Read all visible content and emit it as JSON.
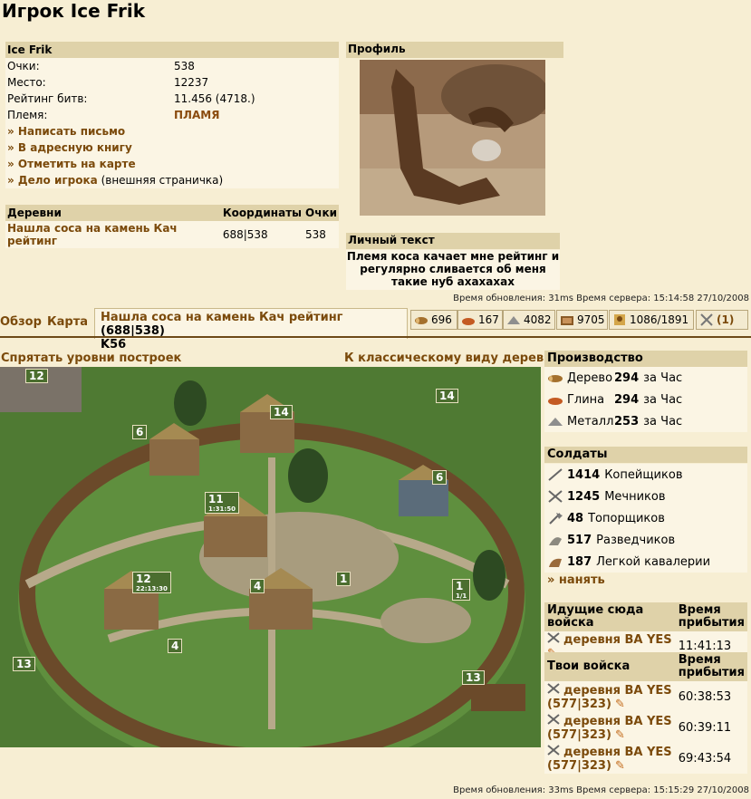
{
  "page_title": "Игрок Ice Frik",
  "player": {
    "name": "Ice Frik",
    "points_label": "Очки:",
    "points": "538",
    "rank_label": "Место:",
    "rank": "12237",
    "battle_label": "Рейтинг битв:",
    "battle": "11.456 (4718.)",
    "tribe_label": "Племя:",
    "tribe": "ПЛАМЯ"
  },
  "actions": [
    {
      "label": "» Написать письмо"
    },
    {
      "label": "» В адресную книгу"
    },
    {
      "label": "» Отметить на карте"
    },
    {
      "label": "» Дело игрока",
      "suffix": "(внешняя страничка)"
    }
  ],
  "villages": {
    "col_village": "Деревни",
    "col_coords": "Координаты",
    "col_points": "Очки",
    "rows": [
      {
        "name": "Нашла coca на камень Кач рейтинг",
        "coords": "688|538",
        "points": "538"
      }
    ]
  },
  "profile": {
    "title": "Профиль",
    "personal_title": "Личный текст",
    "personal_text": "Племя коса качает мне рейтинг и регулярно сливается об меня такие нуб ахахахах"
  },
  "time1": "Время обновления: 31ms Время сервера: 15:14:58 27/10/2008",
  "nav": {
    "overview": "Обзор",
    "map": "Карта",
    "village_name": "Нашла coca на камень Кач рейтинг",
    "village_coords": "(688|538)",
    "village_k": "K56"
  },
  "resources": {
    "wood": "696",
    "clay": "167",
    "iron": "4082",
    "storage": "9705",
    "farm": "1086/1891",
    "attacks": "(1)"
  },
  "map_links": {
    "hide_levels": "Спрятать уровни построек",
    "classic_view": "К классическому виду деревни"
  },
  "buildings": [
    {
      "level": "12"
    },
    {
      "level": "14"
    },
    {
      "level": "6"
    },
    {
      "level": "14"
    },
    {
      "level": "6"
    },
    {
      "level": "11",
      "timer": "1:31:50"
    },
    {
      "level": "12",
      "timer": "22:13:30"
    },
    {
      "level": "4"
    },
    {
      "level": "1"
    },
    {
      "level": "1",
      "timer": "1/1"
    },
    {
      "level": "4"
    },
    {
      "level": "13"
    },
    {
      "level": "13"
    }
  ],
  "production": {
    "title": "Производство",
    "rows": [
      {
        "name": "Дерево",
        "value": "294",
        "unit": "за Час"
      },
      {
        "name": "Глина",
        "value": "294",
        "unit": "за Час"
      },
      {
        "name": "Металл",
        "value": "253",
        "unit": "за Час"
      }
    ]
  },
  "soldiers": {
    "title": "Солдаты",
    "rows": [
      {
        "count": "1414",
        "name": "Копейщиков"
      },
      {
        "count": "1245",
        "name": "Мечников"
      },
      {
        "count": "48",
        "name": "Топорщиков"
      },
      {
        "count": "517",
        "name": "Разведчиков"
      },
      {
        "count": "187",
        "name": "Легкой кавалерии"
      }
    ],
    "hire": "» нанять"
  },
  "incoming": {
    "title": "Идущие сюда войска",
    "time_col": "Время прибытия",
    "rows": [
      {
        "name": "деревня BA YES",
        "time": "11:41:13"
      }
    ]
  },
  "own": {
    "title": "Твои войска",
    "time_col": "Время прибытия",
    "rows": [
      {
        "name": "деревня BA YES",
        "coords": "(577|323)",
        "time": "60:38:53"
      },
      {
        "name": "деревня BA YES",
        "coords": "(577|323)",
        "time": "60:39:11"
      },
      {
        "name": "деревня BA YES",
        "coords": "(577|323)",
        "time": "69:43:54"
      }
    ]
  },
  "time2": "Время обновления: 33ms Время сервера: 15:15:29 27/10/2008",
  "colors": {
    "header_bg": "#dfd2a9",
    "page_bg": "#f7eed3",
    "link": "#7b4a0b"
  }
}
